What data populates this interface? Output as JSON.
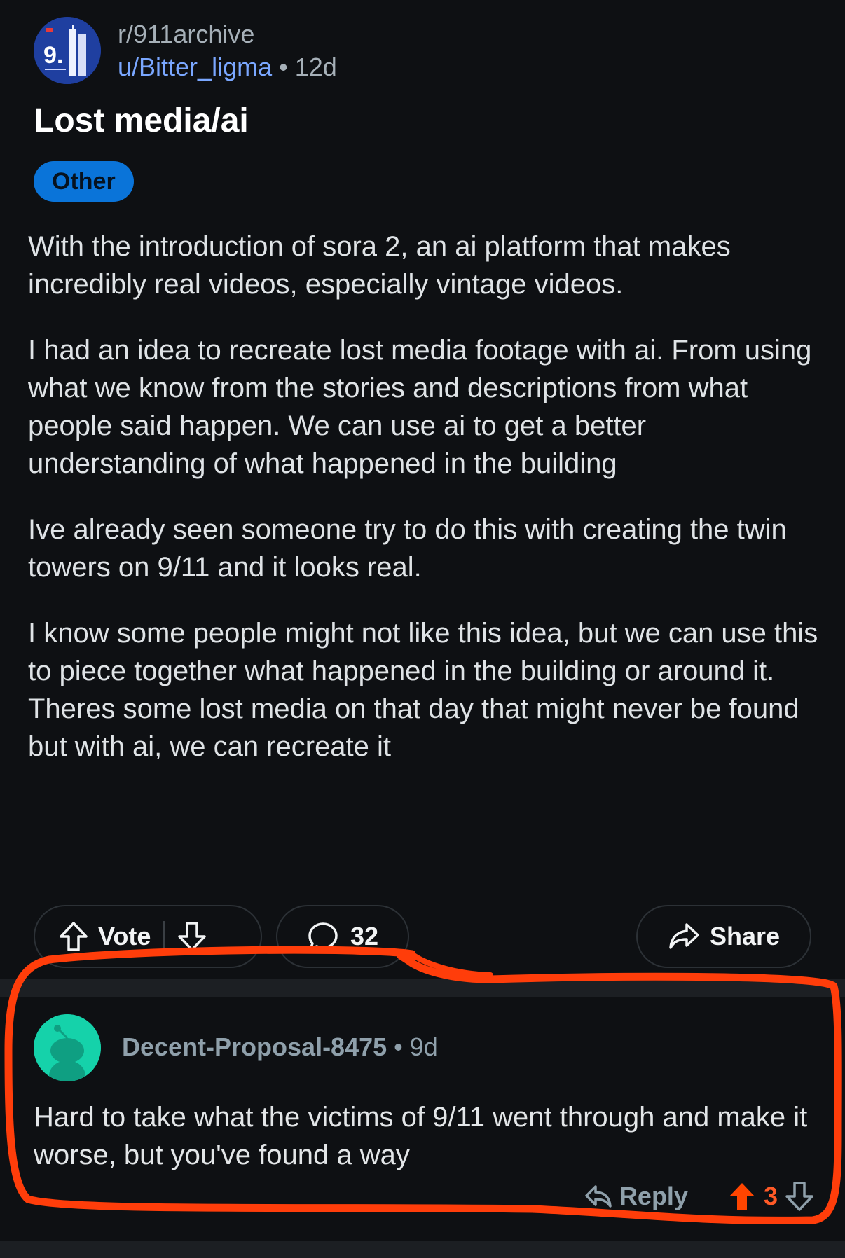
{
  "post": {
    "subreddit": "r/911archive",
    "author": "u/Bitter_ligma",
    "separator": "•",
    "age": "12d",
    "avatar_text": "9.",
    "title": "Lost media/ai",
    "flair": "Other",
    "paragraphs": [
      "With the introduction of sora 2, an ai platform that makes incredibly real videos, especially vintage videos.",
      "I had an idea to recreate lost media footage with ai. From using what we know from the stories and descriptions from what people said happen. We can use ai to get a better understanding of what happened in the building",
      "Ive already seen someone try to do this with creating the twin towers on 9/11 and it looks real.",
      "I know some people might not like this idea, but we can use this to piece together what happened in the building or around it. Theres some lost media on that day that might never be found but with ai, we can recreate it"
    ],
    "actions": {
      "vote_label": "Vote",
      "comment_count": "32",
      "share_label": "Share"
    }
  },
  "comment": {
    "username": "Decent-Proposal-8475",
    "separator": "•",
    "age": "9d",
    "text": "Hard to take what the victims of 9/11 went through and make it worse, but you've found a way",
    "reply_label": "Reply",
    "score": "3"
  },
  "colors": {
    "background": "#0e1013",
    "flair": "#0a74d9",
    "author_link": "#7aa7ff",
    "upvote_active": "#ff4500",
    "highlight_stroke": "#ff3d0a",
    "comment_avatar": "#15d2aa"
  },
  "icons": {
    "upvote": "upvote-arrow-icon",
    "downvote": "downvote-arrow-icon",
    "comment": "speech-bubble-icon",
    "share": "share-arrow-icon",
    "reply": "reply-arrow-icon"
  }
}
